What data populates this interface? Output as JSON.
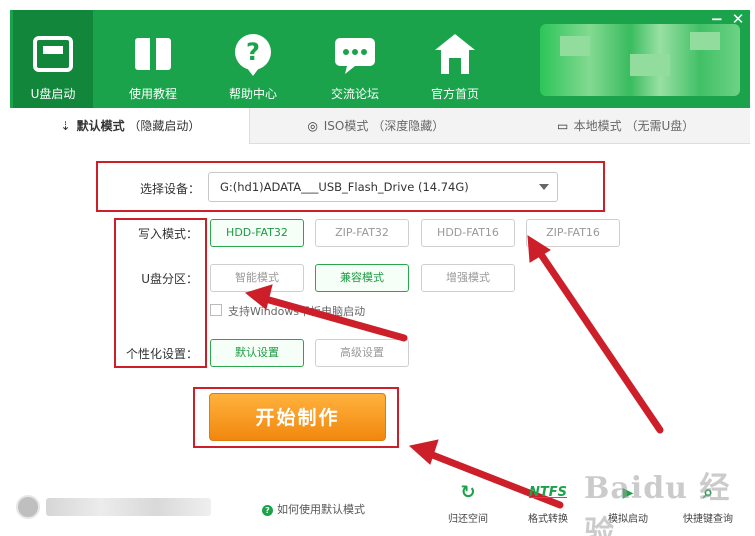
{
  "window": {
    "minimize": "−",
    "close": "✕"
  },
  "nav": [
    {
      "label": "U盘启动",
      "icon": "usb-drive-icon"
    },
    {
      "label": "使用教程",
      "icon": "book-icon"
    },
    {
      "label": "帮助中心",
      "icon": "help-question-icon"
    },
    {
      "label": "交流论坛",
      "icon": "chat-bubble-icon"
    },
    {
      "label": "官方首页",
      "icon": "home-icon"
    }
  ],
  "tabs": [
    {
      "title": "默认模式",
      "note": "（隐藏启动）",
      "icon": "default-mode-icon"
    },
    {
      "title": "ISO模式",
      "note": "（深度隐藏）",
      "icon": "iso-disc-icon"
    },
    {
      "title": "本地模式",
      "note": "（无需U盘）",
      "icon": "monitor-icon"
    }
  ],
  "form": {
    "device_label": "选择设备：",
    "device_value": "G:(hd1)ADATA___USB_Flash_Drive (14.74G)",
    "write_label": "写入模式：",
    "write_options": [
      "HDD-FAT32",
      "ZIP-FAT32",
      "HDD-FAT16",
      "ZIP-FAT16"
    ],
    "partition_label": "U盘分区：",
    "partition_options": [
      "智能模式",
      "兼容模式",
      "增强模式"
    ],
    "checkbox_label": "支持Windows平板电脑启动",
    "personal_label": "个性化设置：",
    "personal_options": [
      "默认设置",
      "高级设置"
    ],
    "start_button": "开始制作"
  },
  "bottom": {
    "help_link": "如何使用默认模式",
    "tools": [
      {
        "label": "归还空间",
        "icon": "restore-space-icon",
        "glyph": "↻"
      },
      {
        "label": "格式转换",
        "icon": "ntfs-convert-icon",
        "glyph": "NTFS"
      },
      {
        "label": "模拟启动",
        "icon": "simulate-boot-icon",
        "glyph": "▶"
      },
      {
        "label": "快捷键查询",
        "icon": "shortcut-search-icon",
        "glyph": "⌕"
      }
    ]
  },
  "watermark": "Baidu 经验",
  "colors": {
    "brand_green": "#1aa34a",
    "annotation_red": "#cc1f2a",
    "start_orange": "#f39a1f"
  }
}
